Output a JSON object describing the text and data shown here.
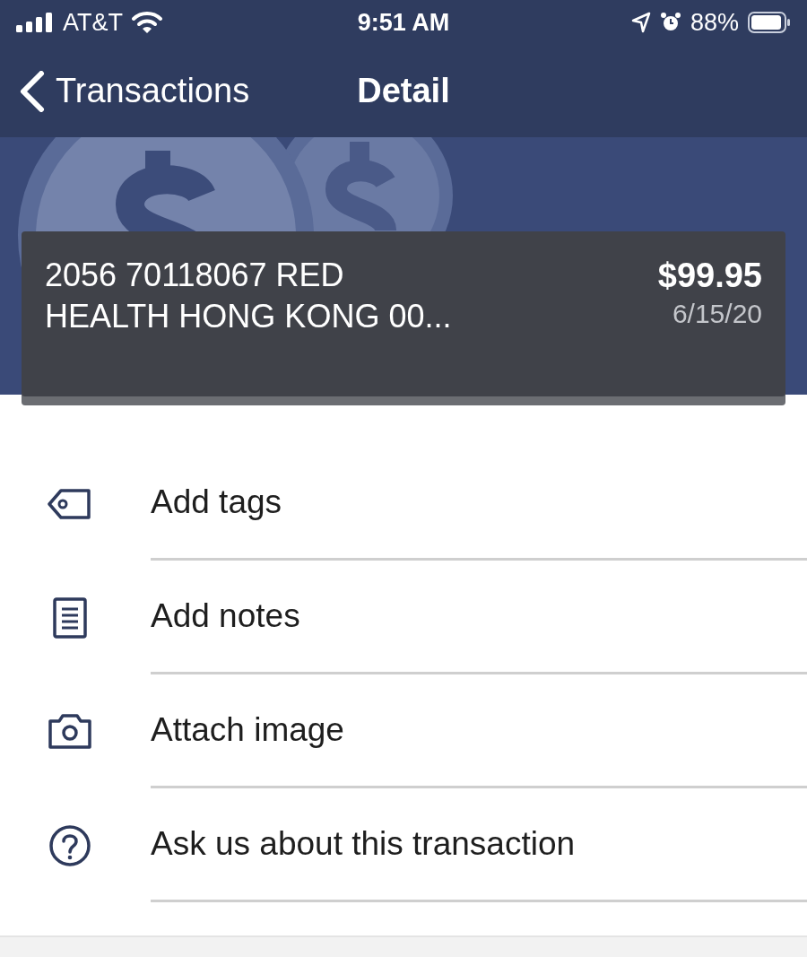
{
  "status_bar": {
    "carrier": "AT&T",
    "time": "9:51 AM",
    "battery": "88%"
  },
  "nav": {
    "back_label": "Transactions",
    "title": "Detail"
  },
  "transaction": {
    "description_lines": [
      "2056 70118067 RED",
      "HEALTH HONG KONG 00..."
    ],
    "amount": "$99.95",
    "date": "6/15/20"
  },
  "actions": [
    {
      "kind": "tag",
      "label": "Add tags"
    },
    {
      "kind": "notes",
      "label": "Add notes"
    },
    {
      "kind": "camera",
      "label": "Attach image"
    },
    {
      "kind": "help",
      "label": "Ask us about this transaction"
    }
  ]
}
